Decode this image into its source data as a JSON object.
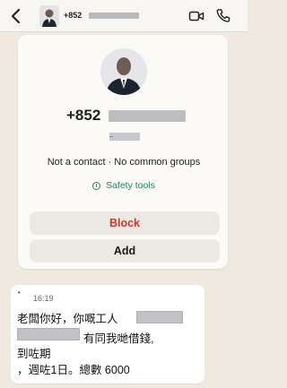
{
  "header": {
    "phone_prefix": "+852",
    "back_icon": "chevron-left-icon",
    "video_icon": "video-camera-icon",
    "call_icon": "phone-icon"
  },
  "contact_card": {
    "phone_prefix": "+852",
    "status_text": "Not a contact · No common groups",
    "safety_tools_label": "Safety tools",
    "block_label": "Block",
    "add_label": "Add"
  },
  "message": {
    "time": "16:19",
    "line1": "老闆你好，你嘅工人",
    "line2": "有同我哋借錢,",
    "line3": "到咗期",
    "line4": "，週咗1日。總數 6000"
  },
  "colors": {
    "background": "#efe9df",
    "block_red": "#c9392f",
    "safety_green": "#1d8a5a"
  }
}
